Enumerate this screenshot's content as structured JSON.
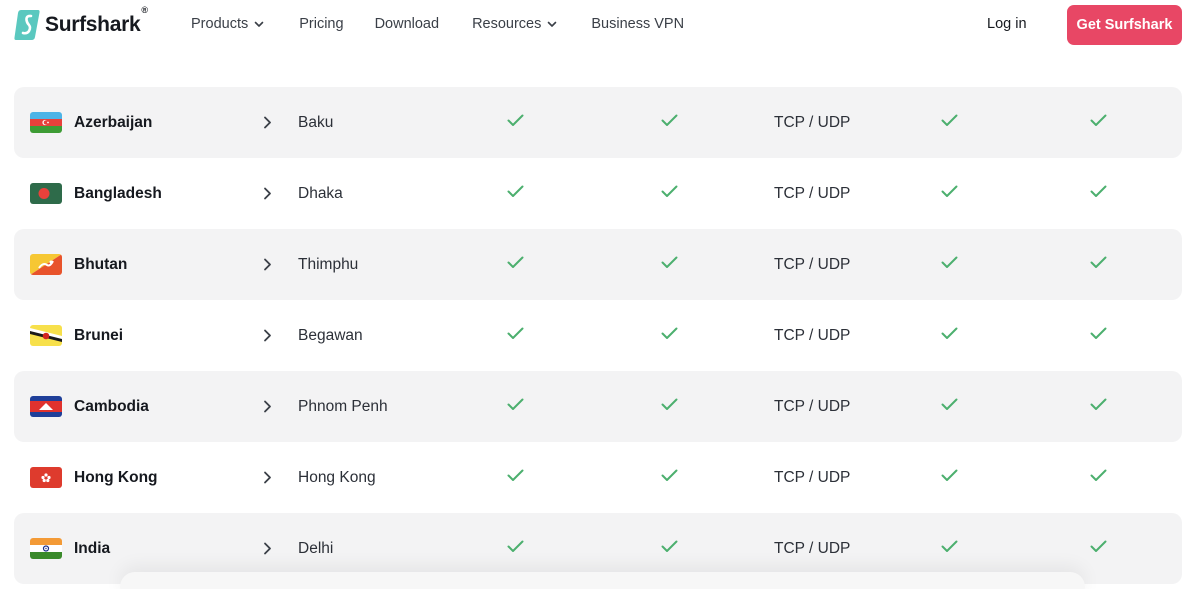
{
  "header": {
    "brand": "Surfshark",
    "brand_mark": "®",
    "nav": [
      {
        "label": "Products",
        "has_dropdown": true
      },
      {
        "label": "Pricing",
        "has_dropdown": false
      },
      {
        "label": "Download",
        "has_dropdown": false
      },
      {
        "label": "Resources",
        "has_dropdown": true
      },
      {
        "label": "Business VPN",
        "has_dropdown": false
      }
    ],
    "login_label": "Log in",
    "cta_label": "Get Surfshark"
  },
  "colors": {
    "brand_teal": "#5ac8bf",
    "cta": "#e84765",
    "check": "#4caf6e",
    "row_shade": "#f3f3f4"
  },
  "table": {
    "rows": [
      {
        "country": "Azerbaijan",
        "flag": "azerbaijan-flag",
        "city": "Baku",
        "col1": true,
        "col2": true,
        "protocol": "TCP / UDP",
        "col3": true,
        "col4": true
      },
      {
        "country": "Bangladesh",
        "flag": "bangladesh-flag",
        "city": "Dhaka",
        "col1": true,
        "col2": true,
        "protocol": "TCP / UDP",
        "col3": true,
        "col4": true
      },
      {
        "country": "Bhutan",
        "flag": "bhutan-flag",
        "city": "Thimphu",
        "col1": true,
        "col2": true,
        "protocol": "TCP / UDP",
        "col3": true,
        "col4": true
      },
      {
        "country": "Brunei",
        "flag": "brunei-flag",
        "city": "Begawan",
        "col1": true,
        "col2": true,
        "protocol": "TCP / UDP",
        "col3": true,
        "col4": true
      },
      {
        "country": "Cambodia",
        "flag": "cambodia-flag",
        "city": "Phnom Penh",
        "col1": true,
        "col2": true,
        "protocol": "TCP / UDP",
        "col3": true,
        "col4": true
      },
      {
        "country": "Hong Kong",
        "flag": "hong-kong-flag",
        "city": "Hong Kong",
        "col1": true,
        "col2": true,
        "protocol": "TCP / UDP",
        "col3": true,
        "col4": true
      },
      {
        "country": "India",
        "flag": "india-flag",
        "city": "Delhi",
        "col1": true,
        "col2": true,
        "protocol": "TCP / UDP",
        "col3": true,
        "col4": true
      }
    ]
  }
}
